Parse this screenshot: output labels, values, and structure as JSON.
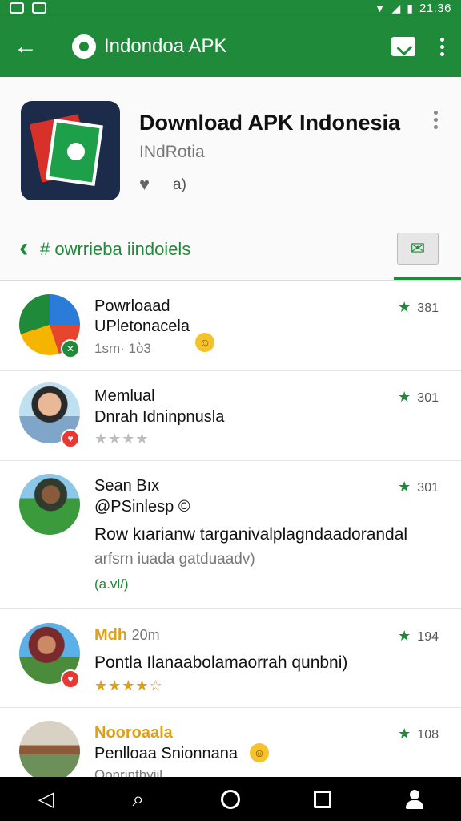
{
  "status_bar": {
    "time": "21:36",
    "wifi_icon": "wifi-icon",
    "signal_icon": "signal-icon",
    "battery_icon": "battery-icon"
  },
  "app_bar": {
    "title": "Indondoa APK",
    "back_icon": "arrow-left-icon",
    "actions": [
      "message-icon",
      "more-vert-icon"
    ]
  },
  "app_header": {
    "name": "Download APK Indonesia",
    "developer": "INdRotia",
    "likes": "a)"
  },
  "filter": {
    "label": "# owrrieba iindoiels",
    "button_icon": "mail-icon"
  },
  "reviews": [
    {
      "name": "Powrloaad",
      "line2": "UPletonacela",
      "meta": "1sm· 1ὸ3",
      "rating": "381",
      "stars": "",
      "extra": "",
      "extra2": ""
    },
    {
      "name": "Memlual",
      "line2": "Dnrah Idninpnusla",
      "meta": "",
      "rating": "301",
      "stars": "★★★★",
      "extra": "",
      "extra2": ""
    },
    {
      "name": "Sean Bıx",
      "line2": "@PSinlesp",
      "meta": "",
      "rating": "301",
      "stars": "",
      "extra": "Row kıarianw targanivalplagndaadorandal",
      "extra2": "arfsrn iuada gatduaadv)",
      "extra3": "(a.vl/)"
    },
    {
      "name": "Mdh",
      "name_suffix": "20m",
      "line2": "Pontla Ilanaabolamaorrah qunbni)",
      "meta": "",
      "rating": "194",
      "stars": "★★★★☆",
      "extra": "",
      "extra2": ""
    },
    {
      "name": "Nooroaala",
      "line2": "Penlloaa Snionnana",
      "meta": "Oonrinthyiil",
      "rating": "108",
      "stars": "",
      "extra": "",
      "extra2": ""
    }
  ],
  "nav": {
    "icons": [
      "back-icon",
      "search-icon",
      "home-icon",
      "recents-icon",
      "profile-icon"
    ]
  },
  "colors": {
    "primary": "#1f8a3a",
    "star": "#e0a013",
    "link": "#2a6fd6"
  }
}
